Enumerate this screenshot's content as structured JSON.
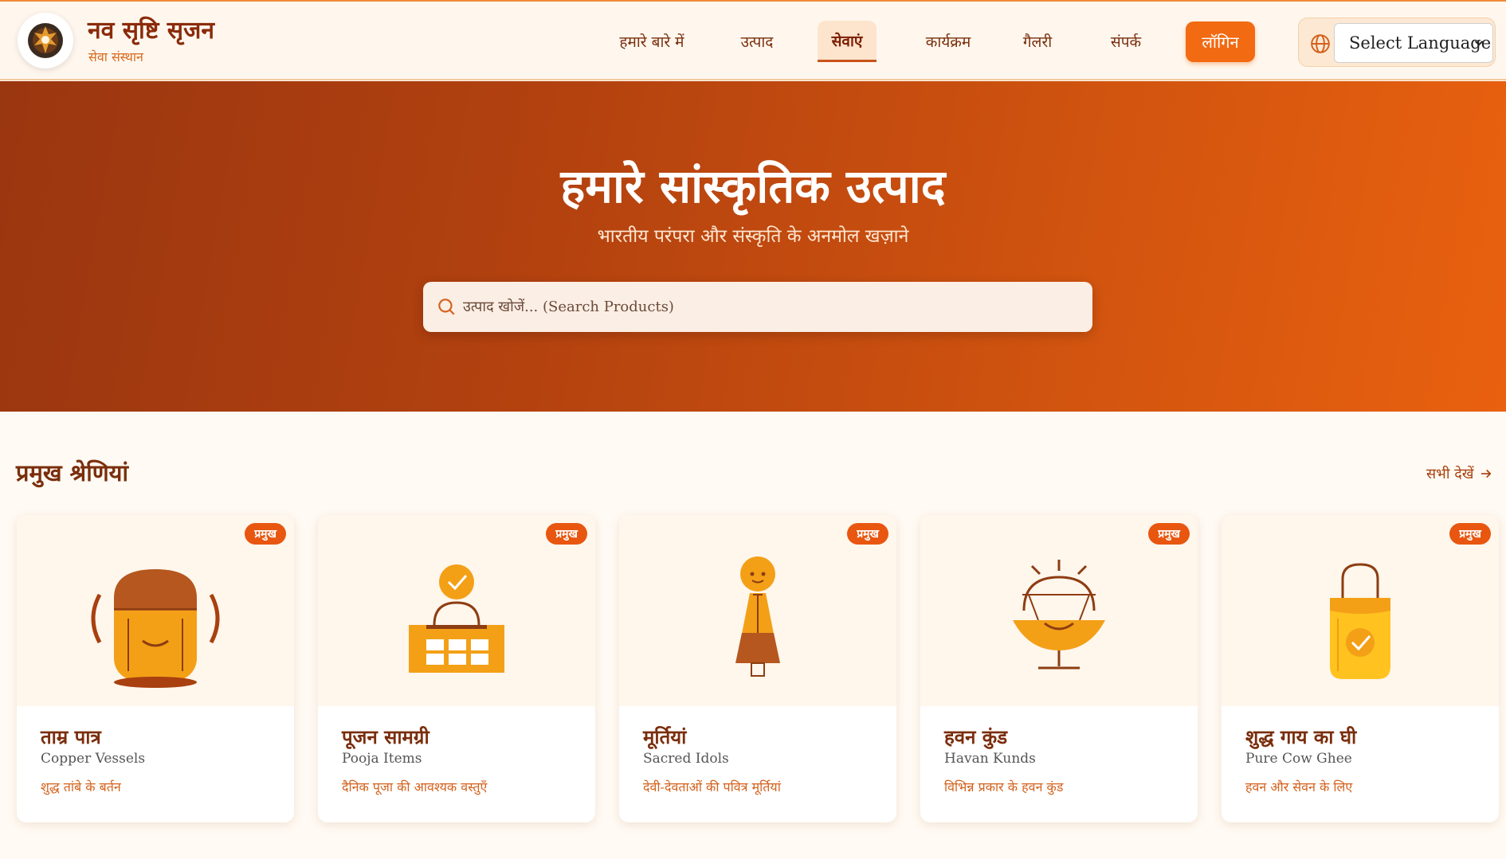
{
  "brand": {
    "title": "नव सृष्टि सृजन",
    "subtitle": "सेवा संस्थान",
    "logo_icon": "emblem-logo-icon"
  },
  "nav": {
    "items": [
      {
        "label": "हमारे बारे में",
        "active": false
      },
      {
        "label": "उत्पाद",
        "active": false
      },
      {
        "label": "सेवाएं",
        "active": true
      },
      {
        "label": "कार्यक्रम",
        "active": false
      },
      {
        "label": "गैलरी",
        "active": false
      },
      {
        "label": "संपर्क",
        "active": false
      }
    ],
    "login_label": "लॉगिन",
    "language_select": "Select Language"
  },
  "hero": {
    "title": "हमारे सांस्कृतिक उत्पाद",
    "subtitle": "भारतीय परंपरा और संस्कृति के अनमोल खज़ाने",
    "search_placeholder": "उत्पाद खोजें... (Search Products)"
  },
  "categories": {
    "title": "प्रमुख श्रेणियां",
    "view_all": "सभी देखें",
    "items": [
      {
        "badge": "प्रमुख",
        "title": "ताम्र पात्र",
        "english": "Copper Vessels",
        "desc": "शुद्ध तांबे के बर्तन",
        "icon": "copper-vessel-icon"
      },
      {
        "badge": "प्रमुख",
        "title": "पूजन सामग्री",
        "english": "Pooja Items",
        "desc": "दैनिक पूजा की आवश्यक वस्तुएँ",
        "icon": "pooja-items-icon"
      },
      {
        "badge": "प्रमुख",
        "title": "मूर्तियां",
        "english": "Sacred Idols",
        "desc": "देवी-देवताओं की पवित्र मूर्तियां",
        "icon": "idol-icon"
      },
      {
        "badge": "प्रमुख",
        "title": "हवन कुंड",
        "english": "Havan Kunds",
        "desc": "विभिन्न प्रकार के हवन कुंड",
        "icon": "havan-kund-icon"
      },
      {
        "badge": "प्रमुख",
        "title": "शुद्ध गाय का घी",
        "english": "Pure Cow Ghee",
        "desc": "हवन और सेवन के लिए",
        "icon": "ghee-jar-icon"
      }
    ]
  },
  "colors": {
    "accent": "#f26a12",
    "brand_dark": "#7a2e0c",
    "hero_start": "#9a3610",
    "hero_end": "#e9610f"
  }
}
